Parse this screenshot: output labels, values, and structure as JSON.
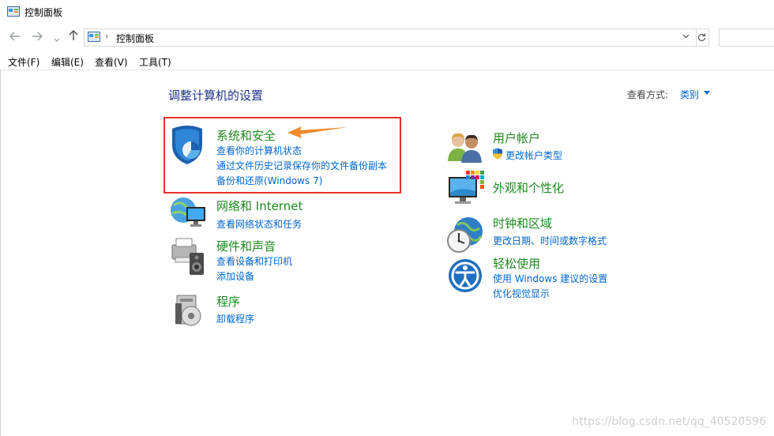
{
  "window": {
    "title": "控制面板"
  },
  "nav": {
    "back_icon": "back-arrow-icon",
    "forward_icon": "forward-arrow-icon",
    "recent_icon": "chevron-down-icon",
    "up_icon": "up-arrow-icon",
    "breadcrumb": "控制面板",
    "refresh_icon": "refresh-icon"
  },
  "menu": {
    "file": "文件(F)",
    "edit": "编辑(E)",
    "view": "查看(V)",
    "tools": "工具(T)"
  },
  "content": {
    "heading": "调整计算机的设置",
    "view_by_label": "查看方式:",
    "view_by_value": "类别"
  },
  "categories_left": [
    {
      "title": "系统和安全",
      "links": [
        "查看你的计算机状态",
        "通过文件历史记录保存你的文件备份副本",
        "备份和还原(Windows 7)"
      ]
    },
    {
      "title": "网络和 Internet",
      "links": [
        "查看网络状态和任务"
      ]
    },
    {
      "title": "硬件和声音",
      "links": [
        "查看设备和打印机",
        "添加设备"
      ]
    },
    {
      "title": "程序",
      "links": [
        "卸载程序"
      ]
    }
  ],
  "categories_right": [
    {
      "title": "用户帐户",
      "links": [
        "更改帐户类型"
      ]
    },
    {
      "title": "外观和个性化",
      "links": []
    },
    {
      "title": "时钟和区域",
      "links": [
        "更改日期、时间或数字格式"
      ]
    },
    {
      "title": "轻松使用",
      "links": [
        "使用 Windows 建议的设置",
        "优化视觉显示"
      ]
    }
  ],
  "watermark": "https://blog.csdn.net/qq_40520596",
  "colors": {
    "accent_link": "#0066cc",
    "category_green": "#1d8a1d",
    "highlight_red": "#e8312f",
    "arrow_orange": "#f08a2c"
  }
}
